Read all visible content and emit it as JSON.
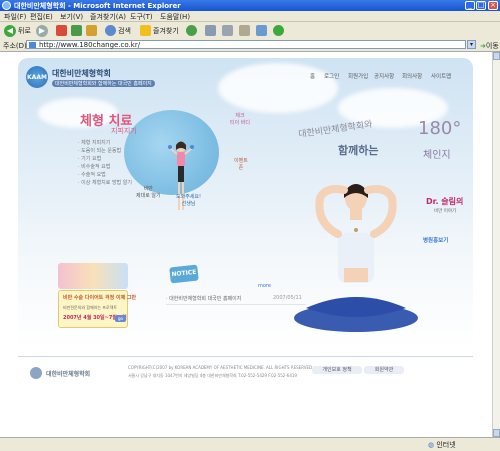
{
  "window": {
    "title": "대한비만체형학회 - Microsoft Internet Explorer"
  },
  "menu": [
    "파일(F)",
    "편집(E)",
    "보기(V)",
    "즐겨찾기(A)",
    "도구(T)",
    "도움말(H)"
  ],
  "toolbar": {
    "back_label": "뒤로",
    "search_label": "검색",
    "favorites_label": "즐겨찾기"
  },
  "address": {
    "label": "주소(D)",
    "url": "http://www.180change.co.kr/",
    "go_label": "이동"
  },
  "status": {
    "zone": "인터넷"
  },
  "site": {
    "logo_text": "KAAM",
    "name": "대한비만체형학회",
    "tagline": "대한비만체형학회와 함께하는 대국민 홈페이지",
    "nav": [
      "홈",
      "로그인",
      "회원가입",
      "공지사항",
      "회의사항",
      "사이트맵"
    ]
  },
  "therapy": {
    "title": "체형 치료",
    "subtitle": "지피지기",
    "items": [
      "· 체형 지피지기",
      "· 도움이 되는 운동법",
      "· 기기 요법",
      "· 비수술적 요법",
      "· 수술적 요법",
      "· 이상 체형치료 방법 알기"
    ]
  },
  "badges": {
    "body_check": "체크\n티이 바디",
    "event": "이벤트\n존",
    "obesity": "비만\n체대로 알기",
    "goods": "도와주세요!\n선생님"
  },
  "slogan": {
    "line1": "대한비만체형학회와",
    "number": "180°",
    "line2": "함께하는",
    "line3": "체인지"
  },
  "doctor": {
    "title": "Dr. 슬림의",
    "subtitle": "비만 이야기"
  },
  "hospital": "병원홍보기",
  "event": {
    "line1": "비만 수술 다이어트 걱정 이제 그만",
    "line2": "비만전문의와 함께하는 프로젝트",
    "period": "2007년 4월 30일~7월 9일",
    "go": "go"
  },
  "notice": {
    "badge": "NOTICE",
    "more": "more",
    "items": [
      {
        "title": "· 대한비만체형학회 대국민 홈페이지",
        "date": "2007/05/11"
      }
    ]
  },
  "footer": {
    "name": "대한비만체형학회",
    "copyright": "COPYRIGHT(C)2007 by KOREAN ACADEMY OF AESTHETIC MEDICINE. ALL RIGHTS RESERVED.",
    "address": "서울시 강남구 대치동 1047번지 세양빌딩 4층 대한비만체형학회 T.02-552-5429 F.02-552-6419",
    "privacy": "개인보호 정책",
    "terms": "회원약관"
  },
  "colors": {
    "accent_pink": "#e0577a",
    "accent_blue": "#3a7bd0",
    "title_blue": "#1554d6"
  }
}
